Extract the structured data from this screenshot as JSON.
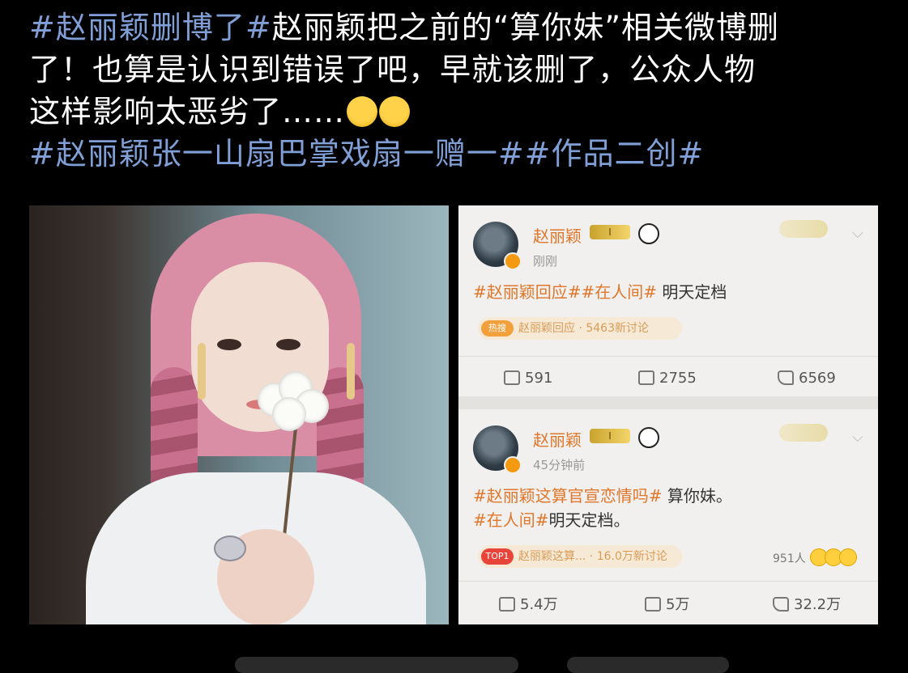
{
  "post": {
    "line1_tag": "#赵丽颖删博了#",
    "line1_text": "赵丽颖把之前的“算你妹”相关微博删",
    "line2_text": "了！也算是认识到错误了吧，早就该删了，公众人物",
    "line3_text": "这样影响太恶劣了……",
    "line4_tags": "#赵丽颖张一山扇巴掌戏扇一赠一##作品二创#"
  },
  "emoji": [
    "scream-emoji",
    "laugh-cry-emoji"
  ],
  "screenshot": {
    "post1": {
      "username": "赵丽颖",
      "level": "I",
      "time": "刚刚",
      "tag": "#赵丽颖回应##在人间#",
      "text": " 明天定档",
      "topic_pill": "热搜",
      "topic_text": "赵丽颖回应 · 5463新讨论",
      "repost": "591",
      "comment": "2755",
      "like": "6569"
    },
    "post2": {
      "username": "赵丽颖",
      "level": "I",
      "time": "45分钟前",
      "tag1": "#赵丽颖这算官宣恋情吗#",
      "text1": " 算你妹。",
      "tag2": "#在人间#",
      "text2": "明天定档。",
      "topic_pill": "TOP1",
      "topic_text": "赵丽颖这算... · 16.0万新讨论",
      "readers": "951人",
      "repost": "5.4万",
      "comment": "5万",
      "like": "32.2万"
    }
  },
  "colors": {
    "hashtag": "#7f9fd6",
    "weibo_orange": "#e0762a",
    "background": "#000000"
  }
}
